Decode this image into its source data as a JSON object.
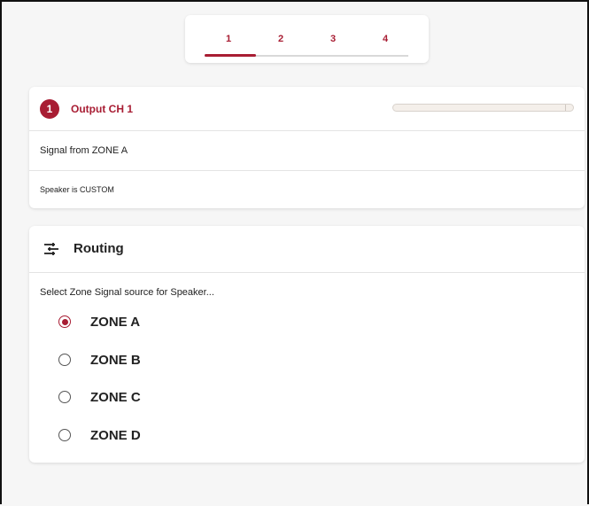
{
  "stepper": {
    "steps": [
      "1",
      "2",
      "3",
      "4"
    ],
    "active_step": 1,
    "progress": 0.25
  },
  "output": {
    "badge": "1",
    "title": "Output CH 1",
    "signal_text": "Signal from ZONE A",
    "speaker_text": "Speaker is CUSTOM",
    "level": 0
  },
  "routing": {
    "icon": "tune-icon",
    "title": "Routing",
    "prompt": "Select Zone Signal source for Speaker...",
    "options": [
      "ZONE A",
      "ZONE B",
      "ZONE C",
      "ZONE D"
    ],
    "selected": "ZONE A"
  },
  "colors": {
    "accent": "#a81d33",
    "background": "#f6f6f6",
    "card": "#ffffff"
  }
}
